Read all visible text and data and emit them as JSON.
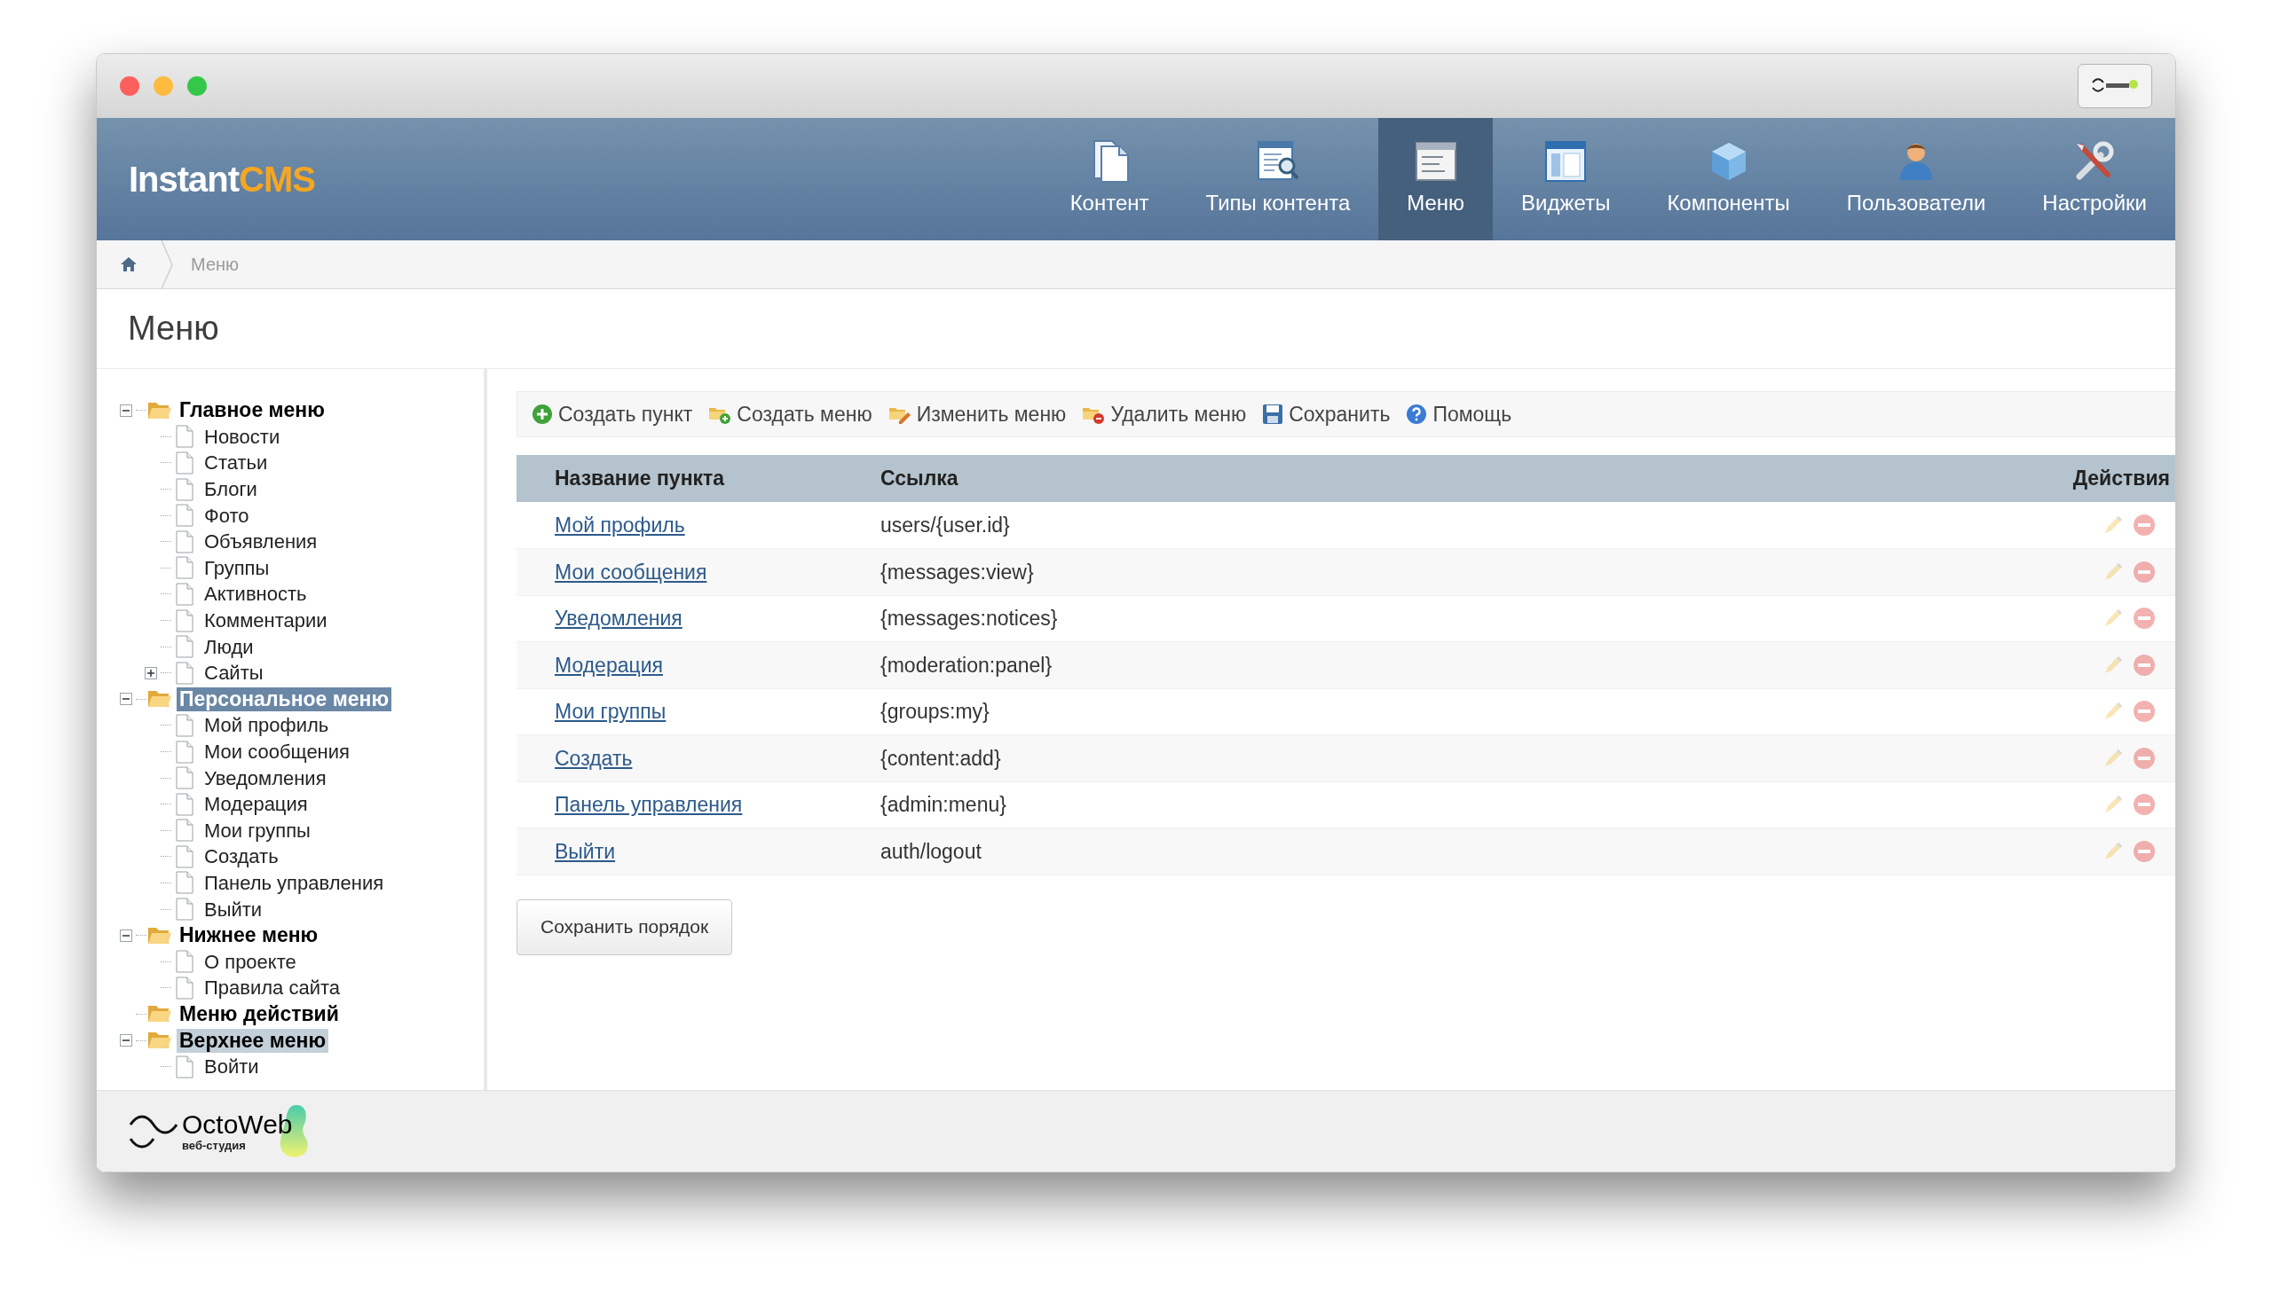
{
  "header": {
    "logo": {
      "part_1": "Instant",
      "part_2": "CMS"
    },
    "nav": [
      {
        "label": "Контент",
        "kind": "content",
        "selected": false
      },
      {
        "label": "Типы контента",
        "kind": "types",
        "selected": false
      },
      {
        "label": "Меню",
        "kind": "menu",
        "selected": true
      },
      {
        "label": "Виджеты",
        "kind": "widgets",
        "selected": false
      },
      {
        "label": "Компоненты",
        "kind": "components",
        "selected": false
      },
      {
        "label": "Пользователи",
        "kind": "users",
        "selected": false
      },
      {
        "label": "Настройки",
        "kind": "settings",
        "selected": false
      }
    ]
  },
  "breadcrumb": [
    "Меню"
  ],
  "page_title": "Меню",
  "tree": [
    {
      "label": "Главное меню",
      "kind": "folder",
      "expandable": true,
      "expanded": true,
      "selected": false,
      "hovered": false,
      "children": [
        {
          "label": "Новости",
          "kind": "page"
        },
        {
          "label": "Статьи",
          "kind": "page"
        },
        {
          "label": "Блоги",
          "kind": "page"
        },
        {
          "label": "Фото",
          "kind": "page"
        },
        {
          "label": "Объявления",
          "kind": "page"
        },
        {
          "label": "Группы",
          "kind": "page"
        },
        {
          "label": "Активность",
          "kind": "page"
        },
        {
          "label": "Комментарии",
          "kind": "page"
        },
        {
          "label": "Люди",
          "kind": "page"
        },
        {
          "label": "Сайты",
          "kind": "page",
          "expandable": true,
          "expanded": false
        }
      ]
    },
    {
      "label": "Персональное меню",
      "kind": "folder",
      "expandable": true,
      "expanded": true,
      "selected": true,
      "hovered": false,
      "children": [
        {
          "label": "Мой профиль",
          "kind": "page"
        },
        {
          "label": "Мои сообщения",
          "kind": "page"
        },
        {
          "label": "Уведомления",
          "kind": "page"
        },
        {
          "label": "Модерация",
          "kind": "page"
        },
        {
          "label": "Мои группы",
          "kind": "page"
        },
        {
          "label": "Создать",
          "kind": "page"
        },
        {
          "label": "Панель управления",
          "kind": "page"
        },
        {
          "label": "Выйти",
          "kind": "page"
        }
      ]
    },
    {
      "label": "Нижнее меню",
      "kind": "folder",
      "expandable": true,
      "expanded": true,
      "selected": false,
      "hovered": false,
      "children": [
        {
          "label": "О проекте",
          "kind": "page"
        },
        {
          "label": "Правила сайта",
          "kind": "page"
        }
      ]
    },
    {
      "label": "Меню действий",
      "kind": "folder",
      "expandable": false,
      "selected": false,
      "hovered": false
    },
    {
      "label": "Верхнее меню",
      "kind": "folder",
      "expandable": true,
      "expanded": true,
      "selected": false,
      "hovered": true,
      "children": [
        {
          "label": "Войти",
          "kind": "page"
        }
      ]
    }
  ],
  "toolbar": [
    {
      "label": "Создать пункт",
      "kind": "add"
    },
    {
      "label": "Создать меню",
      "kind": "folder_add"
    },
    {
      "label": "Изменить меню",
      "kind": "folder_edit"
    },
    {
      "label": "Удалить меню",
      "kind": "folder_delete"
    },
    {
      "label": "Сохранить",
      "kind": "save"
    },
    {
      "label": "Помощь",
      "kind": "help"
    }
  ],
  "table": {
    "columns": [
      "Название пункта",
      "Ссылка",
      "Действия"
    ],
    "rows": [
      {
        "name": "Мой профиль",
        "link": "users/{user.id}"
      },
      {
        "name": "Мои сообщения",
        "link": "{messages:view}"
      },
      {
        "name": "Уведомления",
        "link": "{messages:notices}"
      },
      {
        "name": "Модерация",
        "link": "{moderation:panel}"
      },
      {
        "name": "Мои группы",
        "link": "{groups:my}"
      },
      {
        "name": "Создать",
        "link": "{content:add}"
      },
      {
        "name": "Панель управления",
        "link": "{admin:menu}"
      },
      {
        "name": "Выйти",
        "link": "auth/logout"
      }
    ]
  },
  "save_order_button": "Сохранить порядок",
  "footer": {
    "brand": "OctoWeb",
    "tagline": "веб-студия"
  }
}
